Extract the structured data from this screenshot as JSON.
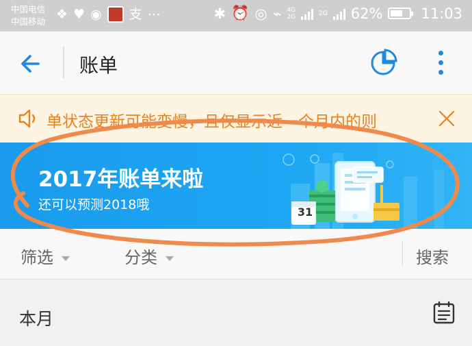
{
  "status_bar": {
    "carrier_1": "中国电信",
    "carrier_2": "中国移动",
    "left_icons": [
      "notification-icon",
      "health-icon",
      "weibo-icon",
      "app-icon",
      "alipay-icon",
      "more-dots-icon"
    ],
    "right_icons": [
      "bluetooth-icon",
      "alarm-icon",
      "eye-icon",
      "wifi-icon"
    ],
    "network_1": "4G",
    "network_2": "2G",
    "network_3": "2G",
    "battery_percent": "62%",
    "battery_level": 0.62,
    "time": "11:03"
  },
  "header": {
    "title": "账单"
  },
  "notice": {
    "text": "单状态更新可能变慢，且仅显示近一个月内的则"
  },
  "banner": {
    "title": "2017年账单来啦",
    "subtitle": "还可以预测2018哦",
    "calendar_day": "31"
  },
  "filter": {
    "filter_label": "筛选",
    "category_label": "分类",
    "search_label": "搜索"
  },
  "month_section": {
    "label": "本月"
  },
  "colors": {
    "accent_blue": "#1e88e5",
    "banner_blue": "#1da6f3",
    "notice_orange": "#e8821d",
    "annotation_orange": "#ef8a4c"
  }
}
